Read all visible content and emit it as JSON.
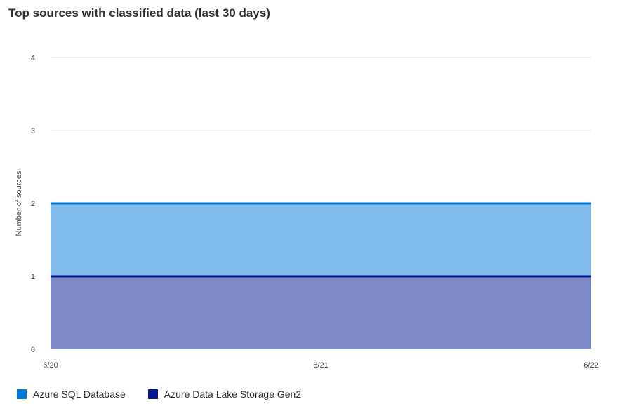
{
  "title": "Top sources with classified data (last 30 days)",
  "chart_data": {
    "type": "area",
    "stacked": true,
    "x": [
      "6/20",
      "6/21",
      "6/22"
    ],
    "xlabel": "",
    "ylabel": "Number of sources",
    "ylim": [
      0,
      4
    ],
    "yticks": [
      0,
      1,
      2,
      3,
      4
    ],
    "grid": true,
    "legend_position": "bottom-left",
    "series": [
      {
        "name": "Azure Data Lake Storage Gen2",
        "values": [
          1,
          1,
          1
        ],
        "line_color": "#00188f",
        "fill_color": "#7f8bc7"
      },
      {
        "name": "Azure SQL Database",
        "values": [
          1,
          1,
          1
        ],
        "line_color": "#0078d4",
        "fill_color": "#7fbae9"
      }
    ],
    "legend": [
      {
        "label": "Azure SQL Database",
        "color": "#0078d4"
      },
      {
        "label": "Azure Data Lake Storage Gen2",
        "color": "#00188f"
      }
    ]
  }
}
